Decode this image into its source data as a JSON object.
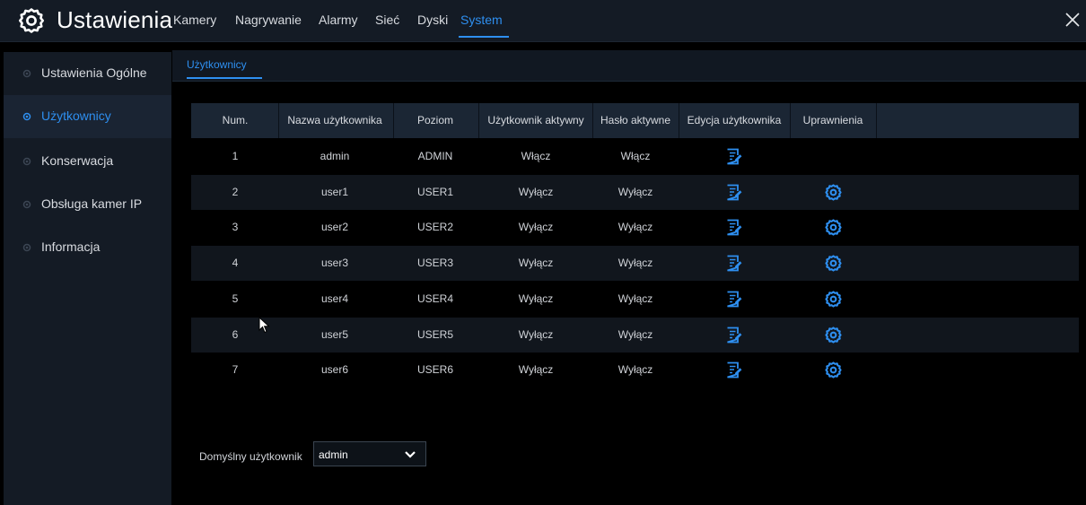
{
  "header": {
    "title": "Ustawienia",
    "tabs": [
      {
        "label": "Kamery"
      },
      {
        "label": "Nagrywanie"
      },
      {
        "label": "Alarmy"
      },
      {
        "label": "Sieć"
      },
      {
        "label": "Dyski"
      },
      {
        "label": "System",
        "active": true
      }
    ]
  },
  "sidebar": {
    "items": [
      {
        "label": "Ustawienia Ogólne"
      },
      {
        "label": "Użytkownicy",
        "active": true
      },
      {
        "label": "Konserwacja"
      },
      {
        "label": "Obsługa kamer IP"
      },
      {
        "label": "Informacja"
      }
    ]
  },
  "subtabs": [
    {
      "label": "Użytkownicy",
      "active": true
    }
  ],
  "table": {
    "headers": [
      "Num.",
      "Nazwa użytkownika",
      "Poziom",
      "Użytkownik aktywny",
      "Hasło aktywne",
      "Edycja użytkownika",
      "Uprawnienia"
    ],
    "rows": [
      {
        "num": "1",
        "name": "admin",
        "level": "ADMIN",
        "active": "Włącz",
        "password": "Włącz",
        "edit_icon": "edit-icon",
        "permissions_icon": null
      },
      {
        "num": "2",
        "name": "user1",
        "level": "USER1",
        "active": "Wyłącz",
        "password": "Wyłącz",
        "edit_icon": "edit-icon",
        "permissions_icon": "gear-icon"
      },
      {
        "num": "3",
        "name": "user2",
        "level": "USER2",
        "active": "Wyłącz",
        "password": "Wyłącz",
        "edit_icon": "edit-icon",
        "permissions_icon": "gear-icon"
      },
      {
        "num": "4",
        "name": "user3",
        "level": "USER3",
        "active": "Wyłącz",
        "password": "Wyłącz",
        "edit_icon": "edit-icon",
        "permissions_icon": "gear-icon"
      },
      {
        "num": "5",
        "name": "user4",
        "level": "USER4",
        "active": "Wyłącz",
        "password": "Wyłącz",
        "edit_icon": "edit-icon",
        "permissions_icon": "gear-icon"
      },
      {
        "num": "6",
        "name": "user5",
        "level": "USER5",
        "active": "Wyłącz",
        "password": "Wyłącz",
        "edit_icon": "edit-icon",
        "permissions_icon": "gear-icon"
      },
      {
        "num": "7",
        "name": "user6",
        "level": "USER6",
        "active": "Wyłącz",
        "password": "Wyłącz",
        "edit_icon": "edit-icon",
        "permissions_icon": "gear-icon"
      }
    ]
  },
  "default_user": {
    "label": "Domyślny użytkownik",
    "value": "admin"
  },
  "colors": {
    "accent": "#2e8ff0",
    "panel": "#141b25",
    "header_row": "#1b2634"
  }
}
